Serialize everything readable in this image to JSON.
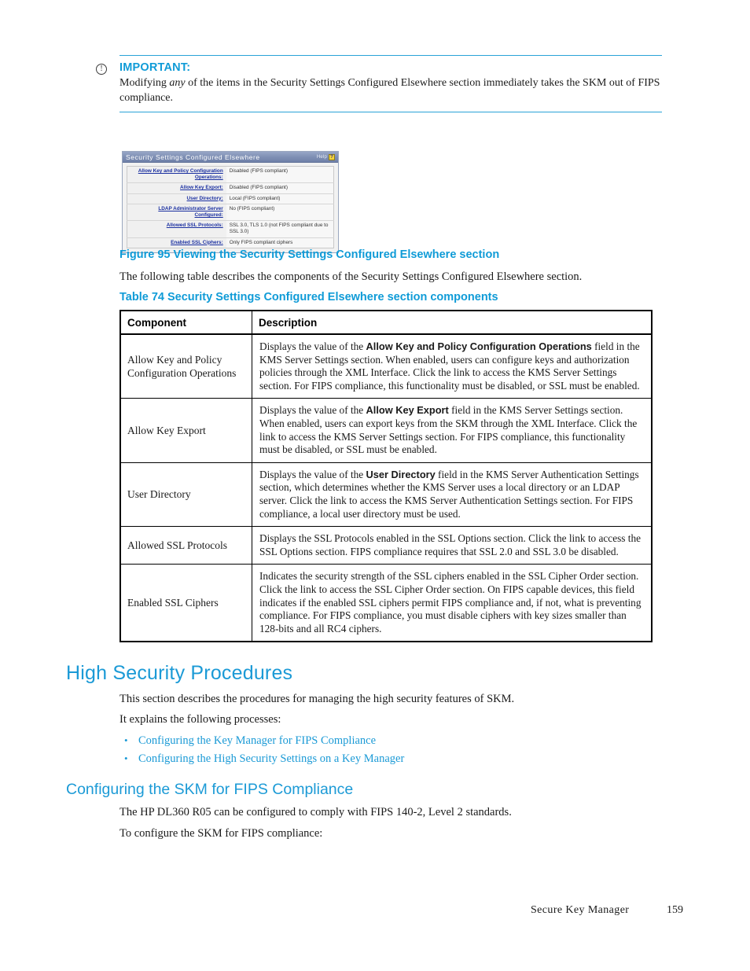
{
  "note": {
    "icon": "important-circle-icon",
    "title": "IMPORTANT:",
    "text_before_italic": "Modifying ",
    "italic_word": "any",
    "text_after_italic": " of the items in the Security Settings Configured Elsewhere section immediately takes the SKM out of FIPS compliance."
  },
  "screenshot": {
    "title": "Security Settings Configured Elsewhere",
    "help_label": "Help",
    "help_icon": "help-question-icon",
    "rows": [
      {
        "label": "Allow Key and Policy Configuration Operations:",
        "value": "Disabled (FIPS compliant)"
      },
      {
        "label": "Allow Key Export:",
        "value": "Disabled (FIPS compliant)"
      },
      {
        "label": "User Directory:",
        "value": "Local (FIPS compliant)"
      },
      {
        "label": "LDAP Administrator Server Configured:",
        "value": "No (FIPS compliant)"
      },
      {
        "label": "Allowed SSL Protocols:",
        "value": "SSL 3.0, TLS 1.0 (not FIPS compliant due to SSL 3.0)"
      },
      {
        "label": "Enabled SSL Ciphers:",
        "value": "Only FIPS compliant ciphers"
      }
    ]
  },
  "figure_caption": "Figure 95 Viewing the Security Settings Configured Elsewhere section",
  "intro_line": "The following table describes the components of the Security Settings Configured Elsewhere section.",
  "table_caption": "Table 74 Security Settings Configured Elsewhere section components",
  "table": {
    "headers": [
      "Component",
      "Description"
    ],
    "rows": [
      {
        "component": "Allow Key and Policy Configuration Operations",
        "desc_pre": "Displays the value of the ",
        "desc_bold": "Allow Key and Policy Configuration Operations",
        "desc_post": " field in the KMS Server Settings section.  When enabled, users can configure keys and authorization policies through the XML Interface.  Click the link to access the KMS Server Settings section.  For FIPS compliance, this functionality must be disabled, or SSL must be enabled."
      },
      {
        "component": "Allow Key Export",
        "desc_pre": "Displays the value of the ",
        "desc_bold": "Allow Key Export",
        "desc_post": " field in the KMS Server Settings section. When enabled, users can export keys from the SKM through the XML Interface. Click the link to access the KMS Server Settings section.  For FIPS compliance, this functionality must be disabled, or SSL must be enabled."
      },
      {
        "component": "User Directory",
        "desc_pre": "Displays the value of the ",
        "desc_bold": "User Directory",
        "desc_post": " field in the KMS Server Authentication Settings section, which determines whether the KMS Server uses a local directory or an LDAP server.  Click the link to access the KMS Server Authentication Settings section. For FIPS compliance, a local user directory must be used."
      },
      {
        "component": "Allowed SSL Protocols",
        "desc_pre": "Displays the SSL Protocols enabled in the SSL Options section.  Click the link to access the SSL Options section.  FIPS compliance requires that SSL 2.0 and SSL 3.0 be disabled.",
        "desc_bold": "",
        "desc_post": ""
      },
      {
        "component": "Enabled SSL Ciphers",
        "desc_pre": "Indicates the security strength of the SSL ciphers enabled in the SSL Cipher Order section.  Click the link to access the SSL Cipher Order section.  On FIPS capable devices, this field indicates if the enabled SSL ciphers permit FIPS compliance and, if not, what is preventing compliance. For FIPS compliance, you must disable ciphers with key sizes smaller than 128-bits and all RC4 ciphers.",
        "desc_bold": "",
        "desc_post": ""
      }
    ]
  },
  "sections": {
    "h1": "High Security Procedures",
    "p1": "This section describes the procedures for managing the high security features of SKM.",
    "p2": "It explains the following processes:",
    "links": [
      "Configuring the Key Manager for FIPS Compliance",
      "Configuring the High Security Settings on a Key Manager"
    ],
    "h2": "Configuring the SKM for FIPS Compliance",
    "p3": "The HP DL360 R05 can be configured to comply with FIPS 140-2, Level 2 standards.",
    "p4": "To configure the SKM for FIPS compliance:"
  },
  "footer": {
    "doc_title": "Secure Key Manager",
    "page_number": "159"
  },
  "colors": {
    "heading_blue": "#1b9ad6",
    "caption_blue": "#0f9bd7",
    "rule_blue": "#2aa3d8",
    "shot_titlebar": "#7d8eb3",
    "shot_link": "#1a2fa0"
  }
}
